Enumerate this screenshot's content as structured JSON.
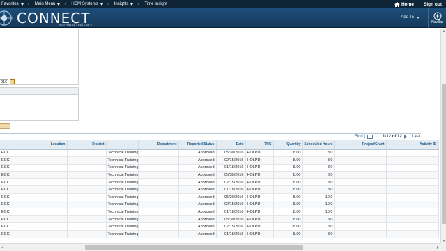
{
  "topbar": {
    "menus": [
      {
        "label": "Favorites"
      },
      {
        "label": "Main Menu"
      },
      {
        "label": "HCM Systems"
      },
      {
        "label": "Insights"
      },
      {
        "label": "Time Insight"
      }
    ],
    "home_label": "Home",
    "signout_label": "Sign out",
    "colors": {
      "bar": "#0e2437"
    }
  },
  "brand": {
    "name": "CONNECT",
    "tagline": "Maryland Judiciary",
    "add_to_label": "Add To",
    "navbar_label": "NavBar"
  },
  "form": {
    "date_fragment": "016"
  },
  "grid": {
    "find_label": "Find",
    "find_sep": "|",
    "count_label": "1-12 of 12",
    "last_label": "Last",
    "columns": [
      "",
      "Location",
      "District",
      "",
      "Department",
      "Reported Status",
      "Date",
      "TRC",
      "Quantity",
      "Scheduled Hours",
      "Project/Grant",
      "Activity ID"
    ],
    "rows": [
      [
        "ECC",
        "",
        "",
        "Technical Training",
        "",
        "Approved",
        "05/30/2016",
        "HOLPD",
        "8.00",
        "8.0",
        "",
        ""
      ],
      [
        "ECC",
        "",
        "",
        "Technical Training",
        "",
        "Approved",
        "02/15/2016",
        "HOLPD",
        "8.00",
        "8.0",
        "",
        ""
      ],
      [
        "ECC",
        "",
        "",
        "Technical Training",
        "",
        "Approved",
        "01/18/2016",
        "HOLPD",
        "8.00",
        "8.0",
        "",
        ""
      ],
      [
        "ECC",
        "",
        "",
        "Technical Training",
        "",
        "Approved",
        "05/30/2016",
        "HOLPD",
        "8.00",
        "8.0",
        "",
        ""
      ],
      [
        "ECC",
        "",
        "",
        "Technical Training",
        "",
        "Approved",
        "02/15/2016",
        "HOLPD",
        "8.00",
        "8.0",
        "",
        ""
      ],
      [
        "ECC",
        "",
        "",
        "Technical Training",
        "",
        "Approved",
        "01/18/2016",
        "HOLPD",
        "8.00",
        "8.0",
        "",
        ""
      ],
      [
        "ECC",
        "",
        "",
        "Technical Training",
        "",
        "Approved",
        "05/30/2016",
        "HOLPD",
        "8.00",
        "10.0",
        "",
        ""
      ],
      [
        "ECC",
        "",
        "",
        "Technical Training",
        "",
        "Approved",
        "02/15/2016",
        "HOLPD",
        "8.00",
        "10.0",
        "",
        ""
      ],
      [
        "ECC",
        "",
        "",
        "Technical Training",
        "",
        "Approved",
        "01/18/2016",
        "HOLPD",
        "8.00",
        "10.0",
        "",
        ""
      ],
      [
        "ECC",
        "",
        "",
        "Technical Training",
        "",
        "Approved",
        "05/30/2016",
        "HOLPD",
        "8.00",
        "8.0",
        "",
        ""
      ],
      [
        "ECC",
        "",
        "",
        "Technical Training",
        "",
        "Approved",
        "02/15/2016",
        "HOLPD",
        "8.00",
        "8.0",
        "",
        ""
      ],
      [
        "ECC",
        "",
        "",
        "Technical Training",
        "",
        "Approved",
        "01/18/2016",
        "HOLPD",
        "8.00",
        "8.0",
        "",
        ""
      ]
    ]
  },
  "icons": {
    "home": "home-icon",
    "navbar": "compass-icon",
    "calendar": "calendar-icon",
    "view_all": "view-all-icon"
  }
}
